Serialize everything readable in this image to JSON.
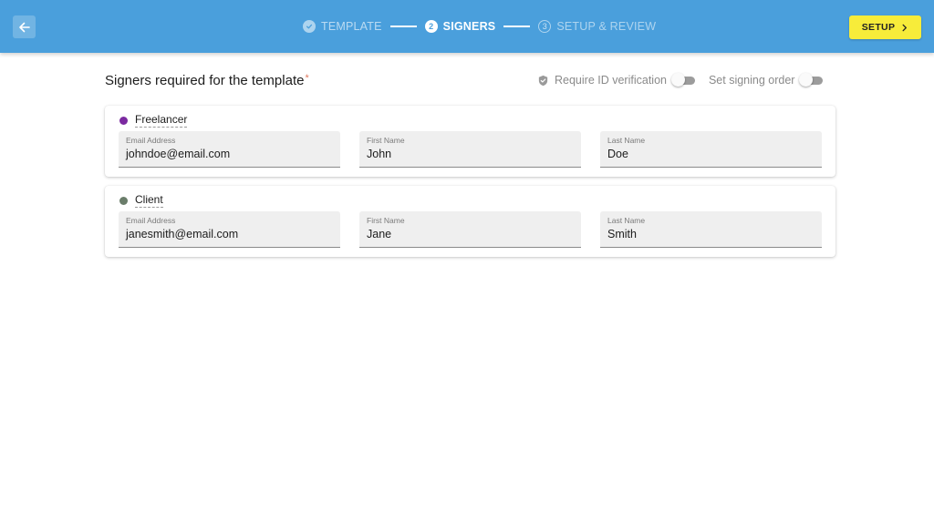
{
  "header": {
    "back_icon": "arrow-left-icon",
    "steps": [
      {
        "number": "",
        "label": "TEMPLATE",
        "state": "done"
      },
      {
        "number": "2",
        "label": "SIGNERS",
        "state": "active"
      },
      {
        "number": "3",
        "label": "SETUP & REVIEW",
        "state": "todo"
      }
    ],
    "setup_button": {
      "label": "SETUP",
      "icon": "chevron-right-icon"
    },
    "colors": {
      "bar": "#4a9fdc",
      "setup_button": "#f7ec3a"
    }
  },
  "section": {
    "title": "Signers required for the template",
    "required_mark": "*"
  },
  "options": {
    "id_verification": {
      "label": "Require ID verification",
      "icon": "shield-check-icon",
      "enabled": false
    },
    "signing_order": {
      "label": "Set signing order",
      "enabled": false
    }
  },
  "signers": [
    {
      "role": "Freelancer",
      "color": "#7b2aa0",
      "fields": [
        {
          "label": "Email Address",
          "value": "johndoe@email.com"
        },
        {
          "label": "First Name",
          "value": "John"
        },
        {
          "label": "Last Name",
          "value": "Doe"
        }
      ]
    },
    {
      "role": "Client",
      "color": "#6a7d6a",
      "fields": [
        {
          "label": "Email Address",
          "value": "janesmith@email.com"
        },
        {
          "label": "First Name",
          "value": "Jane"
        },
        {
          "label": "Last Name",
          "value": "Smith"
        }
      ]
    }
  ]
}
